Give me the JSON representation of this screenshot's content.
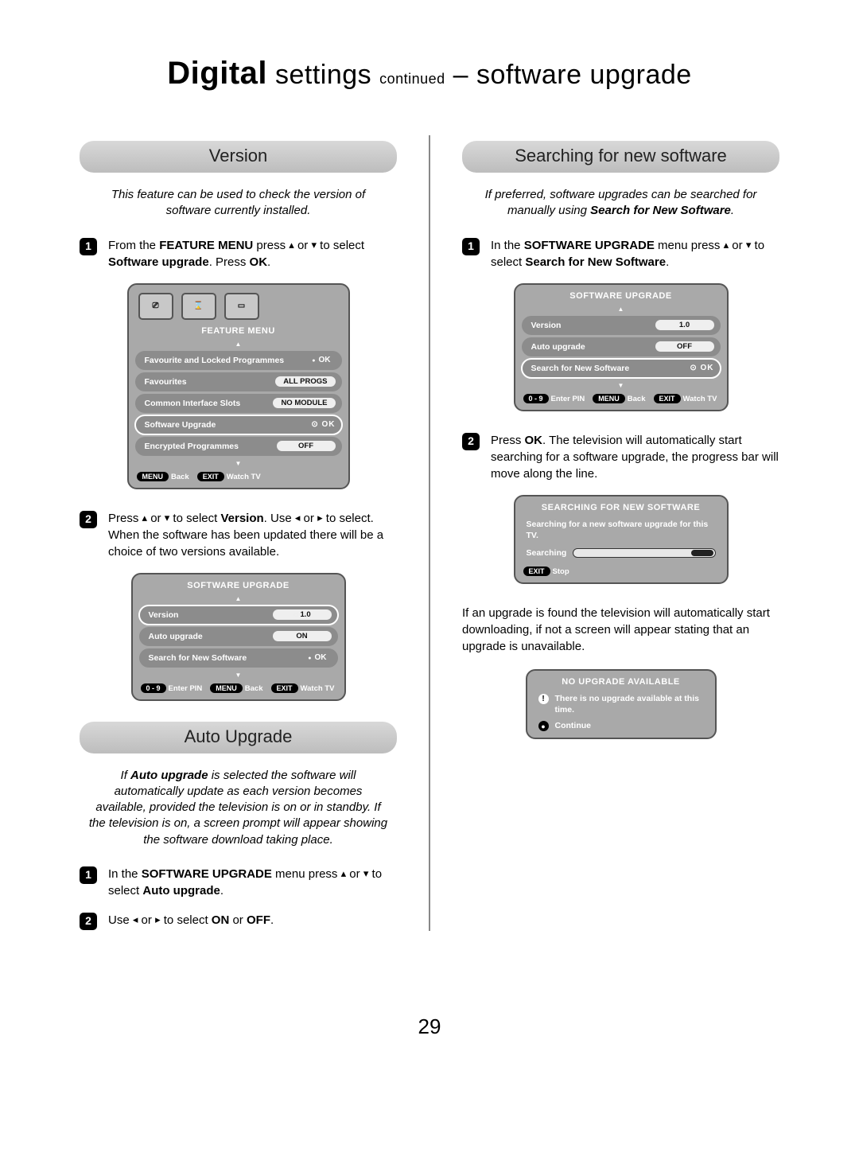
{
  "title": {
    "p1": "Digital",
    "p2": "settings",
    "p3": "continued",
    "p4": "– software upgrade"
  },
  "page_number": "29",
  "left": {
    "version": {
      "heading": "Version",
      "intro": "This feature can be used to check the version of software currently installed.",
      "step1": "From the FEATURE MENU press ▴ or ▾ to select Software upgrade. Press OK.",
      "step2": "Press ▴ or ▾ to select Version. Use ◂ or ▸ to select. When the software has been updated there will be a choice of two versions available."
    },
    "feature_menu": {
      "title": "FEATURE MENU",
      "rows": [
        {
          "label": "Favourite and Locked Programmes",
          "value": "OK",
          "ok": true
        },
        {
          "label": "Favourites",
          "value": "ALL PROGS"
        },
        {
          "label": "Common Interface Slots",
          "value": "NO MODULE"
        },
        {
          "label": "Software Upgrade",
          "value": "OK",
          "sel": true,
          "arrows": true
        },
        {
          "label": "Encrypted Programmes",
          "value": "OFF"
        }
      ],
      "foot": [
        {
          "pill": "MENU",
          "t": "Back"
        },
        {
          "pill": "EXIT",
          "t": "Watch TV"
        }
      ]
    },
    "sw_upgrade_menu_left": {
      "title": "SOFTWARE UPGRADE",
      "rows": [
        {
          "label": "Version",
          "value": "1.0",
          "sel": true,
          "nav": true
        },
        {
          "label": "Auto upgrade",
          "value": "ON"
        },
        {
          "label": "Search for New Software",
          "value": "OK",
          "ok": true
        }
      ],
      "foot": [
        {
          "pill": "0 - 9",
          "t": "Enter PIN"
        },
        {
          "pill": "MENU",
          "t": "Back"
        },
        {
          "pill": "EXIT",
          "t": "Watch TV"
        }
      ]
    },
    "auto_upgrade": {
      "heading": "Auto Upgrade",
      "intro": "If Auto upgrade is selected the software will automatically update as each version becomes available, provided the television is on or in standby. If the television is on, a screen prompt will appear showing the software download taking place.",
      "step1": "In the SOFTWARE UPGRADE menu press ▴ or ▾ to select Auto upgrade.",
      "step2": "Use ◂ or ▸ to select ON or OFF."
    }
  },
  "right": {
    "search": {
      "heading": "Searching for new software",
      "intro": "If preferred, software upgrades can be searched for manually using Search for New Software.",
      "step1": "In the SOFTWARE UPGRADE menu press ▴ or ▾ to select Search for New Software.",
      "step2": "Press OK. The television will automatically start searching for a software upgrade, the progress bar will move along the line.",
      "after": "If an upgrade is found the television will automatically start downloading, if not a screen will appear stating that an upgrade is unavailable."
    },
    "sw_upgrade_menu_right": {
      "title": "SOFTWARE UPGRADE",
      "rows": [
        {
          "label": "Version",
          "value": "1.0"
        },
        {
          "label": "Auto upgrade",
          "value": "OFF"
        },
        {
          "label": "Search for New Software",
          "value": "OK",
          "sel": true,
          "arrows": true
        }
      ],
      "foot": [
        {
          "pill": "0 - 9",
          "t": "Enter PIN"
        },
        {
          "pill": "MENU",
          "t": "Back"
        },
        {
          "pill": "EXIT",
          "t": "Watch TV"
        }
      ]
    },
    "searching_box": {
      "title": "SEARCHING FOR NEW SOFTWARE",
      "line1": "Searching for a new software upgrade for this TV.",
      "progress_label": "Searching",
      "foot": [
        {
          "pill": "EXIT",
          "t": "Stop"
        }
      ]
    },
    "no_upgrade_box": {
      "title": "NO UPGRADE AVAILABLE",
      "msg": "There is no upgrade available at this time.",
      "continue": "Continue"
    }
  }
}
